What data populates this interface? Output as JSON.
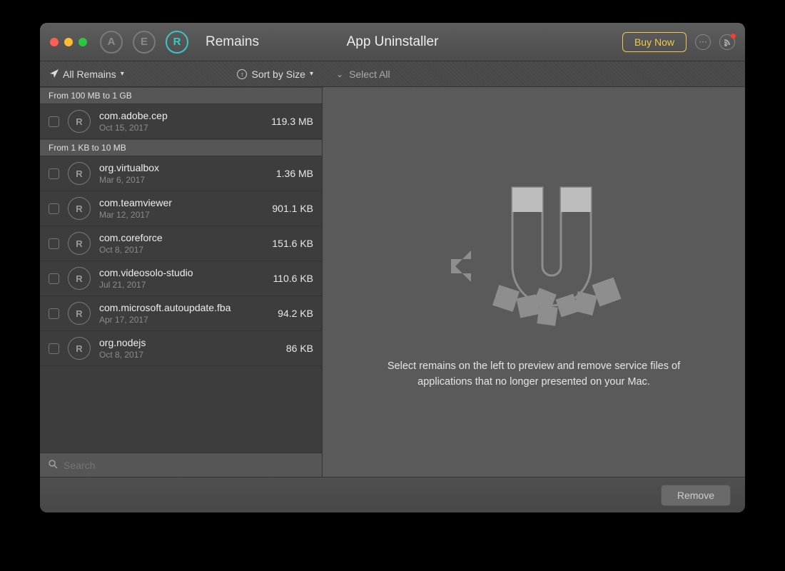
{
  "titlebar": {
    "mode_a": "A",
    "mode_e": "E",
    "mode_r": "R",
    "mode_label": "Remains",
    "app_title": "App Uninstaller",
    "buy_label": "Buy Now"
  },
  "toolbar": {
    "filter_label": "All Remains",
    "sort_label": "Sort by Size",
    "select_all_label": "Select All"
  },
  "sections": [
    {
      "header": "From 100 MB to 1 GB",
      "items": [
        {
          "name": "com.adobe.cep",
          "date": "Oct 15, 2017",
          "size": "119.3 MB"
        }
      ]
    },
    {
      "header": "From 1 KB to 10 MB",
      "items": [
        {
          "name": "org.virtualbox",
          "date": "Mar 6, 2017",
          "size": "1.36 MB"
        },
        {
          "name": "com.teamviewer",
          "date": "Mar 12, 2017",
          "size": "901.1 KB"
        },
        {
          "name": "com.coreforce",
          "date": "Oct 8, 2017",
          "size": "151.6 KB"
        },
        {
          "name": "com.videosolo-studio",
          "date": "Jul 21, 2017",
          "size": "110.6 KB"
        },
        {
          "name": "com.microsoft.autoupdate.fba",
          "date": "Apr 17, 2017",
          "size": "94.2 KB"
        },
        {
          "name": "org.nodejs",
          "date": "Oct 8, 2017",
          "size": "86 KB"
        }
      ]
    }
  ],
  "search": {
    "placeholder": "Search"
  },
  "content": {
    "message": "Select remains on the left to preview and remove service files of applications that no longer presented on your Mac."
  },
  "footer": {
    "remove_label": "Remove"
  }
}
